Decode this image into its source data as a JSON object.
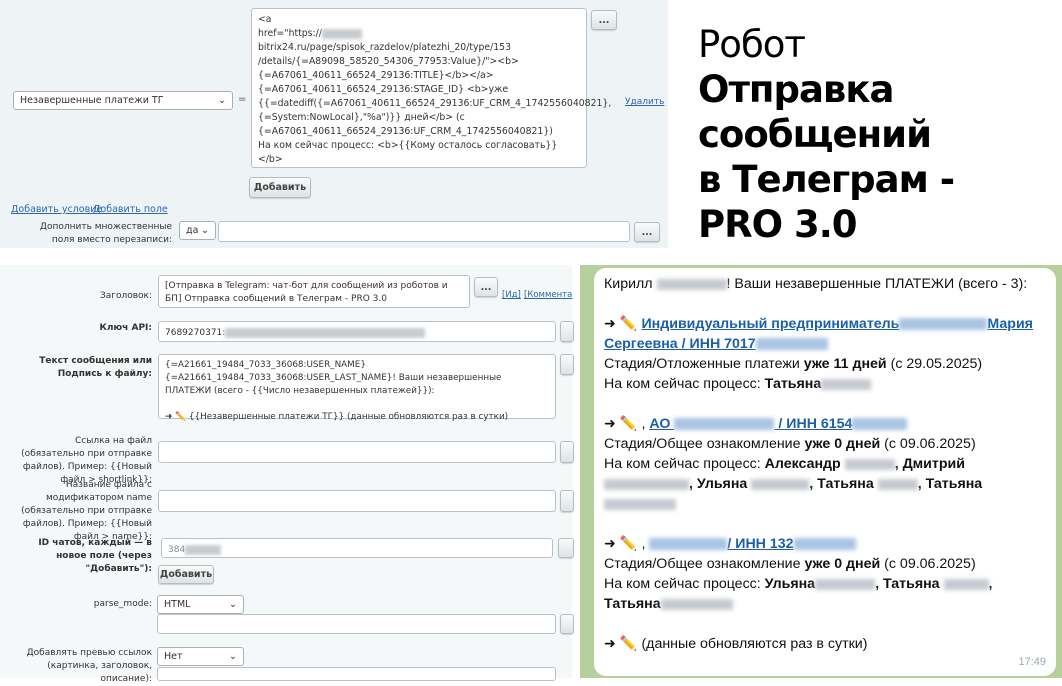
{
  "top": {
    "field_select": "Незавершенные платежи ТГ",
    "equals": "=",
    "value_lines": [
      "<a",
      "href=\"https://",
      "bitrix24.ru/page/spisok_razdelov/platezhi_20/type/153",
      "/details/{=A89098_58520_54306_77953:Value}/\"><b>",
      "{=A67061_40611_66524_29136:TITLE}</b></a>",
      "{=A67061_40611_66524_29136:STAGE_ID} <b>уже",
      "{{=datediff({=A67061_40611_66524_29136:UF_CRM_4_1742556040821},",
      "{=System:NowLocal},\"%a\")}} дней</b> (с",
      "{=A67061_40611_66524_29136:UF_CRM_4_1742556040821})",
      "На ком сейчас процесс: <b>{{Кому осталось согласовать}}</b>",
      "",
      "➜ ✏️"
    ],
    "dots": "...",
    "delete": "Удалить",
    "add": "Добавить",
    "add_condition": "Добавить условие",
    "add_field": "Добавить поле",
    "append_label": "Дополнить множественные поля вместо перезаписи:",
    "append_value": "да"
  },
  "title": {
    "line1": "Робот",
    "line2": "Отправка",
    "line3": "сообщений",
    "line4": "в Телеграм -",
    "line5": "PRO 3.0"
  },
  "form": {
    "header_label": "Заголовок:",
    "header_value": "[Отправка в Telegram: чат-бот для сообщений из роботов и БП] Отправка сообщений в Телеграм - PRO 3.0",
    "id_link": "[Ид]",
    "comment_link": "[Коммента",
    "api_label": "Ключ API:",
    "api_value": "7689270371:",
    "text_label": "Текст сообщения или Подпись к файлу:",
    "text_value": "{=A21661_19484_7033_36068:USER_NAME} {=A21661_19484_7033_36068:USER_LAST_NAME}! Ваши незавершенные ПЛАТЕЖИ (всего - {{Число незавершенных платежей}}):\n\n➜ ✏️ {{Незавершенные платежи ТГ}} (данные обновляются раз в сутки)",
    "file_link_label": "Ссылка на файл (обязательно при отправке файлов). Пример: {{Новый файл > shortlink}}:",
    "file_name_label": "Название файла с модификатором name (обязательно при отправке файлов). Пример: {{Новый файл > name}}:",
    "chat_ids_label": "ID чатов, каждый — в новое поле (через \"Добавить\"):",
    "chat_id_value": "384",
    "add": "Добавить",
    "parse_mode_label": "parse_mode:",
    "parse_mode_value": "HTML",
    "preview_label": "Добавлять превью ссылок (картинка, заголовок, описание):",
    "preview_value": "Нет",
    "dots": "..."
  },
  "message": {
    "greeting_a": "Кирилл",
    "greeting_b": "! Ваши незавершенные ПЛАТЕЖИ (всего - 3):",
    "arrow": "➜ ✏️",
    "item1_link_a": "Индивидуальный предприниматель",
    "item1_link_b": "Мария Сергеевна / ИНН 7017",
    "item1_stage": "Стадия/Отложенные платежи ",
    "item1_days": "уже 11 дней",
    "item1_since": " (с 29.05.2025)",
    "who_label": "На ком сейчас процесс: ",
    "item1_who": "Татьяна",
    "item2_link_a": "АО",
    "item2_link_b": "/ ИНН 6154",
    "item2_stage": "Стадия/Общее ознакомление ",
    "item2_days": "уже 0 дней",
    "item2_since": " (с 09.06.2025)",
    "item2_who1": "Александр",
    "item2_who2": ", Дмитрий",
    "item2_who3": ", Ульяна",
    "item2_who4": ", Татьяна",
    "item2_who5": ", Татьяна",
    "item3_link": "/ ИНН 132",
    "item3_stage": "Стадия/Общее ознакомление ",
    "item3_days": "уже 0 дней",
    "item3_since": " (с 09.06.2025)",
    "item3_who1": "Ульяна",
    "item3_who2": ", Татьяна",
    "item3_who3": "Татьяна",
    "footer": "(данные обновляются раз в сутки)",
    "time": "17:49",
    "comma": ","
  },
  "colors": {
    "link": "#2a67b0",
    "tg_bg": "#b7cf9a"
  }
}
